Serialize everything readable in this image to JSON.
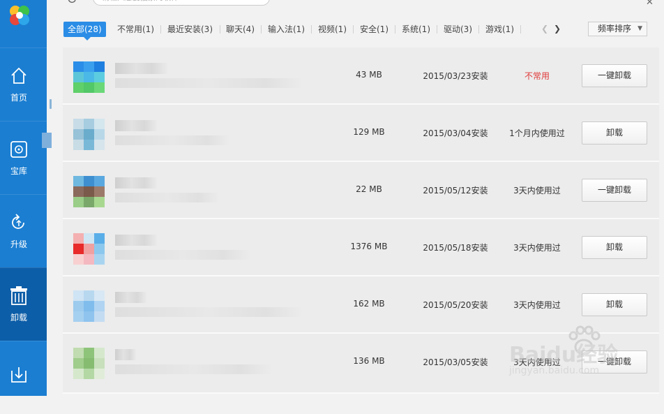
{
  "sidebar": {
    "items": [
      {
        "label": "首页",
        "icon": "home-icon"
      },
      {
        "label": "宝库",
        "icon": "vault-icon"
      },
      {
        "label": "升级",
        "icon": "upgrade-icon"
      },
      {
        "label": "卸载",
        "icon": "uninstall-icon",
        "active": true
      },
      {
        "label": "",
        "icon": "download-icon"
      }
    ],
    "accent_color": "#1b7ed1",
    "active_color": "#0d5ea8"
  },
  "search": {
    "placeholder": "请输入您要搜索的软件"
  },
  "tabs": [
    {
      "label": "全部(28)",
      "active": true
    },
    {
      "label": "不常用(1)"
    },
    {
      "label": "最近安装(3)"
    },
    {
      "label": "聊天(4)"
    },
    {
      "label": "输入法(1)"
    },
    {
      "label": "视频(1)"
    },
    {
      "label": "安全(1)"
    },
    {
      "label": "系统(1)"
    },
    {
      "label": "驱动(3)"
    },
    {
      "label": "游戏(1)"
    }
  ],
  "sort": {
    "selected": "频率排序"
  },
  "apps": [
    {
      "size": "43 MB",
      "install_date": "2015/03/23安装",
      "usage": "不常用",
      "usage_warn": true,
      "action": "一键卸载"
    },
    {
      "size": "129 MB",
      "install_date": "2015/03/04安装",
      "usage": "1个月内使用过",
      "action": "卸载"
    },
    {
      "size": "22 MB",
      "install_date": "2015/05/12安装",
      "usage": "3天内使用过",
      "action": "一键卸载"
    },
    {
      "size": "1376 MB",
      "install_date": "2015/05/18安装",
      "usage": "3天内使用过",
      "action": "卸载"
    },
    {
      "size": "162 MB",
      "install_date": "2015/05/20安装",
      "usage": "3天内使用过",
      "action": "卸载"
    },
    {
      "size": "136 MB",
      "install_date": "2015/03/05安装",
      "usage": "3天内使用过",
      "action": "一键卸载"
    }
  ],
  "watermark": {
    "main": "Baidu经验",
    "sub": "jingyan.baidu.com"
  },
  "colors": {
    "tab_active": "#2b8de6",
    "warn_text": "#e03a3a"
  }
}
